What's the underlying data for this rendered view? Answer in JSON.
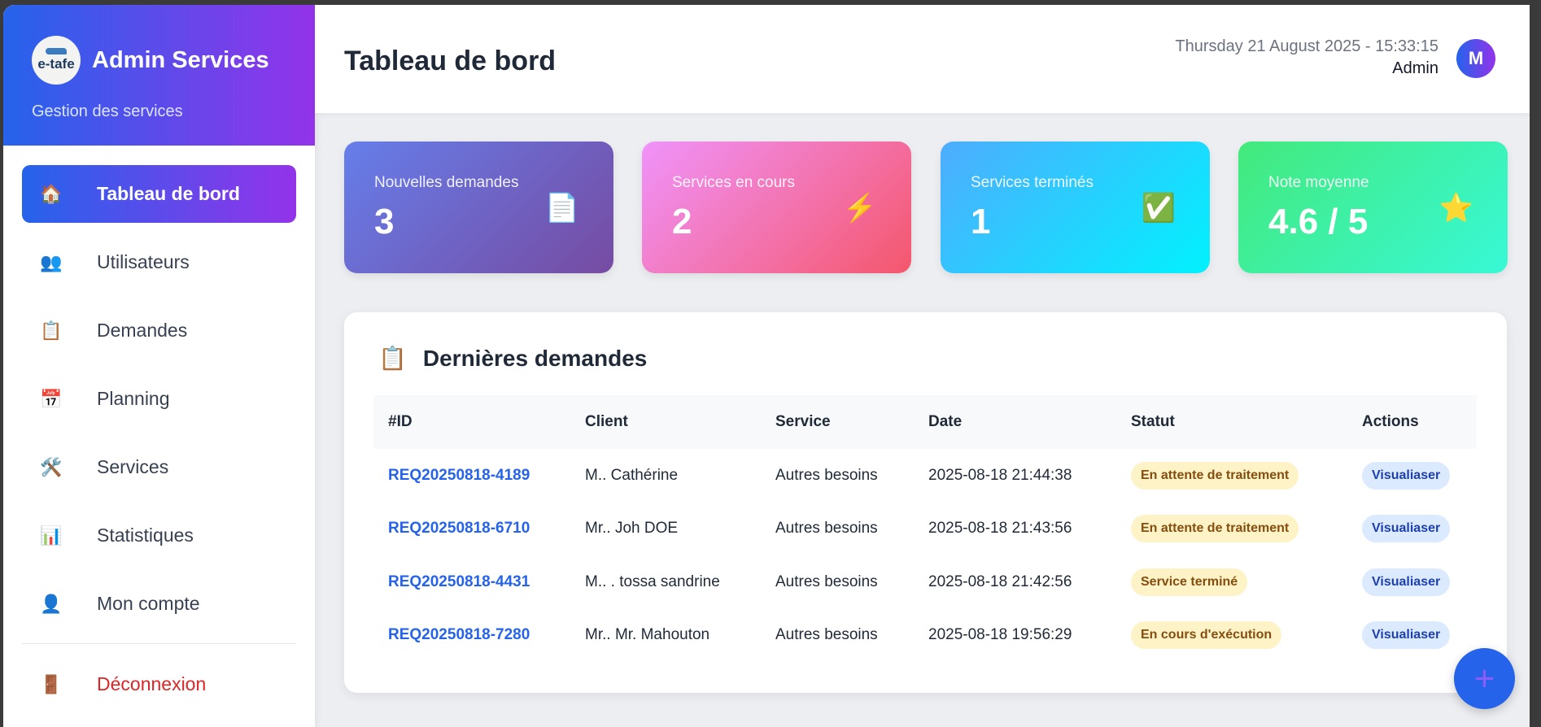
{
  "sidebar": {
    "logo_text": "e-tafe",
    "title": "Admin Services",
    "subtitle": "Gestion des services",
    "items": [
      {
        "label": "Tableau de bord",
        "icon": "🏠"
      },
      {
        "label": "Utilisateurs",
        "icon": "👥"
      },
      {
        "label": "Demandes",
        "icon": "📋"
      },
      {
        "label": "Planning",
        "icon": "📅"
      },
      {
        "label": "Services",
        "icon": "🛠️"
      },
      {
        "label": "Statistiques",
        "icon": "📊"
      },
      {
        "label": "Mon compte",
        "icon": "👤"
      }
    ],
    "logout": {
      "label": "Déconnexion",
      "icon": "🚪"
    }
  },
  "header": {
    "title": "Tableau de bord",
    "datetime": "Thursday 21 August 2025 - 15:33:15",
    "user": "Admin",
    "avatar": "M"
  },
  "stats": [
    {
      "label": "Nouvelles demandes",
      "value": "3",
      "icon": "📄",
      "gradient": [
        "#667eea",
        "#764ba2"
      ]
    },
    {
      "label": "Services en cours",
      "value": "2",
      "icon": "⚡",
      "gradient": [
        "#f093fb",
        "#f5576c"
      ]
    },
    {
      "label": "Services terminés",
      "value": "1",
      "icon": "✅",
      "gradient": [
        "#4facfe",
        "#00f2fe"
      ]
    },
    {
      "label": "Note moyenne",
      "value": "4.6 / 5",
      "icon": "⭐",
      "gradient": [
        "#43e97b",
        "#38f9d7"
      ]
    }
  ],
  "recent": {
    "title": "Dernières demandes",
    "icon": "📋",
    "columns": [
      "#ID",
      "Client",
      "Service",
      "Date",
      "Statut",
      "Actions"
    ],
    "rows": [
      {
        "id": "REQ20250818-4189",
        "client": "M.. Cathérine",
        "service": "Autres besoins",
        "date": "2025-08-18 21:44:38",
        "status": "En attente de traitement",
        "action": "Visualiaser"
      },
      {
        "id": "REQ20250818-6710",
        "client": "Mr.. Joh DOE",
        "service": "Autres besoins",
        "date": "2025-08-18 21:43:56",
        "status": "En attente de traitement",
        "action": "Visualiaser"
      },
      {
        "id": "REQ20250818-4431",
        "client": "M.. . tossa sandrine",
        "service": "Autres besoins",
        "date": "2025-08-18 21:42:56",
        "status": "Service terminé",
        "action": "Visualiaser"
      },
      {
        "id": "REQ20250818-7280",
        "client": "Mr.. Mr. Mahouton",
        "service": "Autres besoins",
        "date": "2025-08-18 19:56:29",
        "status": "En cours d'exécution",
        "action": "Visualiaser"
      }
    ]
  },
  "fab": {
    "icon": "+"
  }
}
